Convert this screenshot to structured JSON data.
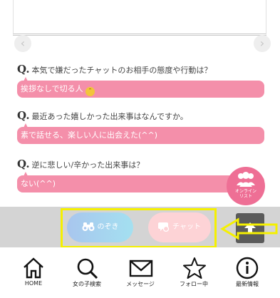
{
  "carousel": {
    "prev_icon": "chevron-left-icon",
    "next_icon": "chevron-right-icon"
  },
  "qa": [
    {
      "q_mark": "Q.",
      "question": "本気で嫌だったチャットのお相手の態度や行動は？",
      "answer": "挨拶なしで切る人"
    },
    {
      "q_mark": "Q.",
      "question": "最近あった嬉しかった出来事はなんですか。",
      "answer": "素で話せる、楽しい人に出会えた(^^)"
    },
    {
      "q_mark": "Q.",
      "question": "逆に悲しい/辛かった出来事は？",
      "answer": "ない(^^)"
    }
  ],
  "online_list": {
    "label_line1": "オンライン",
    "label_line2": "リスト",
    "icon": "people-icon"
  },
  "actions": {
    "peek_label": "のぞき",
    "chat_label": "チャット",
    "top_icon": "arrow-up-icon"
  },
  "tabs": [
    {
      "label": "HOME",
      "icon": "home-icon"
    },
    {
      "label": "女の子検索",
      "icon": "search-icon"
    },
    {
      "label": "メッセージ",
      "icon": "mail-icon"
    },
    {
      "label": "フォロー中",
      "icon": "star-icon"
    },
    {
      "label": "最新情報",
      "icon": "info-icon"
    }
  ],
  "colors": {
    "answer_bg": "#f48faa",
    "online_bg": "#ee6f95",
    "highlight": "#f5f000",
    "chat_pill": "#fdd3d6"
  }
}
